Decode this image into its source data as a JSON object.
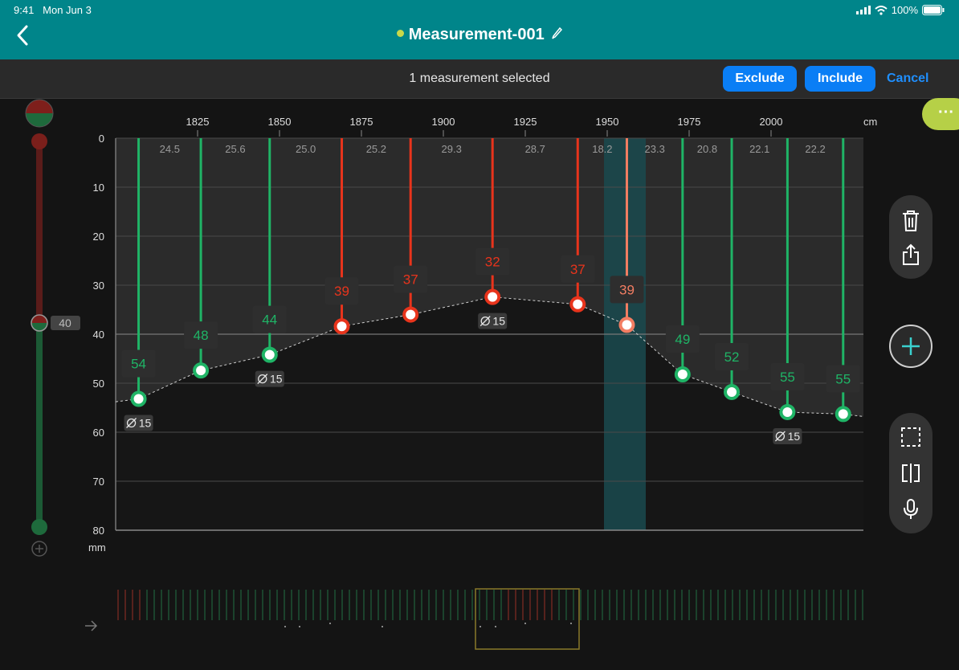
{
  "status": {
    "time": "9:41",
    "date": "Mon Jun 3",
    "battery": "100%"
  },
  "header": {
    "title": "Measurement-001",
    "dot_color": "#c7d84a"
  },
  "selection": {
    "text": "1 measurement selected",
    "exclude_label": "Exclude",
    "include_label": "Include",
    "cancel_label": "Cancel"
  },
  "slider": {
    "value": "40"
  },
  "menu": {
    "more_label": "···"
  },
  "chart_data": {
    "type": "line",
    "x_unit": "cm",
    "y_unit": "mm",
    "x_ticks": [
      1825,
      1850,
      1875,
      1900,
      1925,
      1950,
      1975,
      2000
    ],
    "y_ticks": [
      0,
      10,
      20,
      30,
      40,
      50,
      60,
      70,
      80
    ],
    "threshold": 40,
    "spacings": [
      "24.5",
      "25.6",
      "25.0",
      "25.2",
      "29.3",
      "28.7",
      "18.2",
      "23.3",
      "20.8",
      "22.1",
      "22.2"
    ],
    "points": [
      {
        "x": 1807,
        "y": 53.2,
        "label": "54",
        "status": "ok",
        "diameter": "15"
      },
      {
        "x": 1826,
        "y": 47.4,
        "label": "48",
        "status": "ok"
      },
      {
        "x": 1847,
        "y": 44.2,
        "label": "44",
        "status": "ok",
        "diameter": "15"
      },
      {
        "x": 1869,
        "y": 38.4,
        "label": "39",
        "status": "low"
      },
      {
        "x": 1890,
        "y": 36.0,
        "label": "37",
        "status": "low"
      },
      {
        "x": 1915,
        "y": 32.4,
        "label": "32",
        "status": "low",
        "diameter": "15"
      },
      {
        "x": 1941,
        "y": 33.9,
        "label": "37",
        "status": "low"
      },
      {
        "x": 1956,
        "y": 38.1,
        "label": "39",
        "status": "selected"
      },
      {
        "x": 1973,
        "y": 48.2,
        "label": "49",
        "status": "ok"
      },
      {
        "x": 1988,
        "y": 51.8,
        "label": "52",
        "status": "ok"
      },
      {
        "x": 2005,
        "y": 55.9,
        "label": "55",
        "status": "ok",
        "diameter": "15"
      },
      {
        "x": 2022,
        "y": 56.3,
        "label": "55",
        "status": "ok"
      }
    ],
    "colors": {
      "ok": "#1fb466",
      "low": "#e8341c",
      "selected": "#f27d62"
    }
  }
}
